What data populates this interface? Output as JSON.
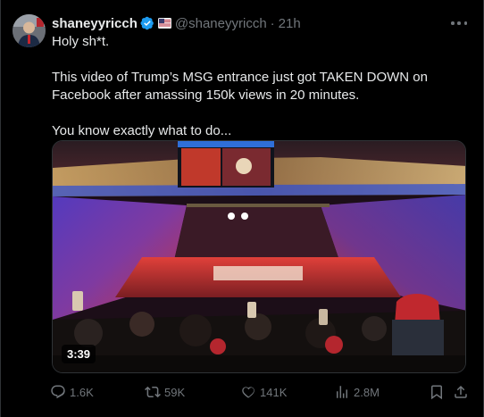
{
  "post": {
    "display_name": "shaneyyricch",
    "handle": "@shaneyyricch",
    "separator": "·",
    "time": "21h",
    "verified": true,
    "lines": [
      "Holy sh*t.",
      "This video of Trump’s MSG entrance just got TAKEN DOWN on Facebook after amassing 150k views in 20 minutes.",
      "You know exactly what to do..."
    ],
    "video_duration": "3:39"
  },
  "actions": {
    "replies": "1.6K",
    "reposts": "59K",
    "likes": "141K",
    "views": "2.8M"
  },
  "colors": {
    "background": "#000000",
    "text": "#e7e9ea",
    "muted": "#71767b",
    "verified": "#1d9bf0",
    "border": "#2f3336"
  },
  "icons": [
    "avatar",
    "verified-badge-icon",
    "flag-icon",
    "more-icon",
    "reply-icon",
    "retweet-icon",
    "like-icon",
    "views-icon",
    "bookmark-icon",
    "share-icon"
  ]
}
